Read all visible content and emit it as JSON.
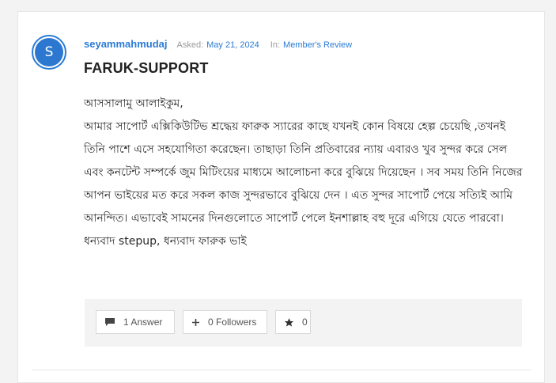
{
  "post": {
    "avatar_letter": "S",
    "username": "seyammahmudaj",
    "asked_label": "Asked:",
    "asked_date": "May 21, 2024",
    "in_label": "In:",
    "category": "Member's Review",
    "title": "FARUK-SUPPORT",
    "content": {
      "line1": "আসসালামু আলাইকুম,",
      "body": "আমার সাপোর্ট এক্সিকিউটিভ শ্রদ্ধেয় ফারুক স্যারের কাছে যখনই কোন বিষয়ে হেল্প চেয়েছি ,তখনই তিনি পাশে এসে সহযোগিতা করেছেন। তাছাড়া তিনি প্রতিবারের ন্যায় এবারও খুব সুন্দর করে সেল এবং কনটেন্ট সম্পর্কে জুম মিটিংয়ের মাধ্যমে আলোচনা করে বুঝিয়ে দিয়েছেন । সব সময় তিনি নিজের আপন ভাইয়ের মত করে সকল কাজ সুন্দরভাবে বুঝিয়ে দেন । এত সুন্দর সাপোর্ট পেয়ে সত্যিই আমি আনন্দিত। এভাবেই সামনের দিনগুলোতে সাপোর্ট পেলে ইনশাল্লাহ বহু দূরে এগিয়ে যেতে পারবো। ধন্যবাদ stepup, ধন্যবাদ ফারুক ভাই"
    }
  },
  "actions": {
    "answer_label": "1 Answer",
    "follow_label": "0 Followers",
    "star_count": "0"
  },
  "icons": {
    "answer": "comment-icon",
    "follow": "plus-icon",
    "star": "star-icon"
  },
  "colors": {
    "accent": "#2a7bd5",
    "background": "#f3f3f3",
    "card": "#ffffff"
  }
}
